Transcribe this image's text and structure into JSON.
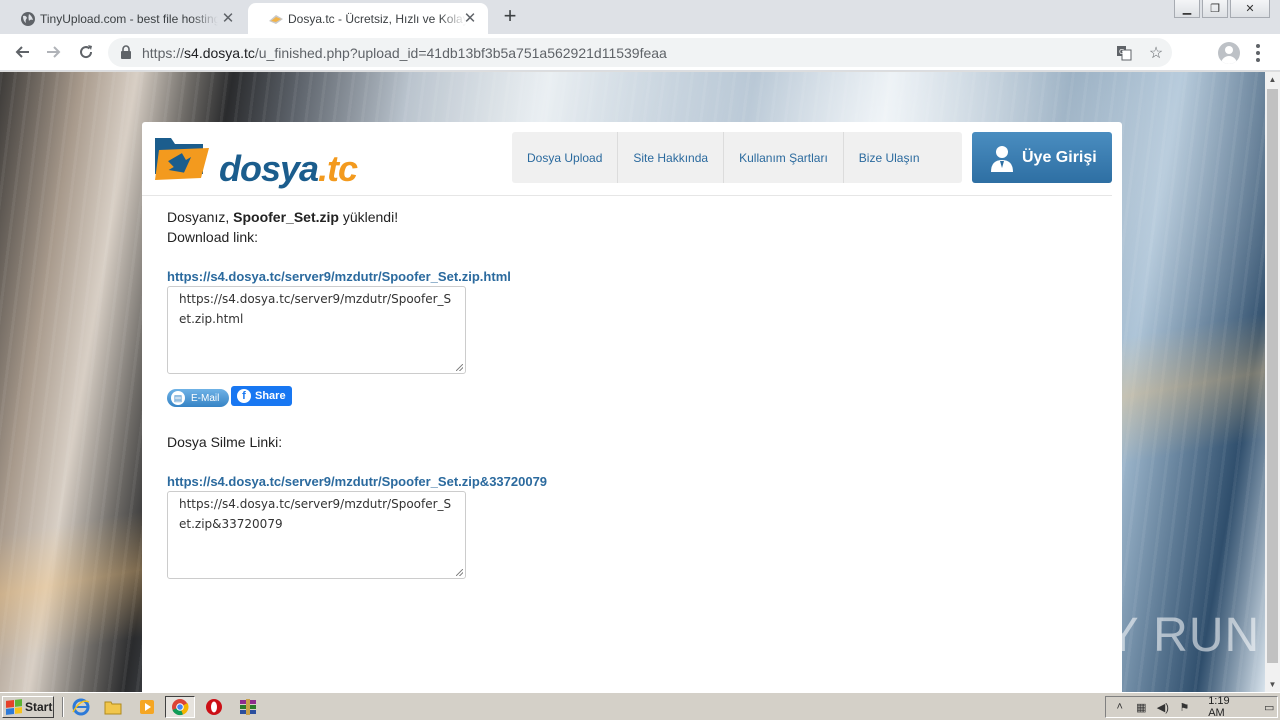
{
  "browser": {
    "tabs": [
      {
        "title": "TinyUpload.com - best file hosting solution",
        "active": false
      },
      {
        "title": "Dosya.tc - Ücretsiz, Hızlı ve Kolay Dosya Upload",
        "active": true
      }
    ],
    "url_scheme": "https://",
    "url_host": "s4.dosya.tc",
    "url_path": "/u_finished.php?upload_id=41db13bf3b5a751a562921d11539feaa"
  },
  "site": {
    "logo_main": "dosya",
    "logo_suffix": ".tc",
    "nav": [
      "Dosya Upload",
      "Site Hakkında",
      "Kullanım Şartları",
      "Bize Ulaşın"
    ],
    "login_label": "Üye Girişi"
  },
  "upload": {
    "prefix": "Dosyanız, ",
    "filename": "Spoofer_Set.zip",
    "suffix": " yüklendi!",
    "download_label": "Download link:",
    "download_link": "https://s4.dosya.tc/server9/mzdutr/Spoofer_Set.zip.html",
    "download_textarea": "https://s4.dosya.tc/server9/mzdutr/Spoofer_Set.zip.html",
    "email_label": "E-Mail",
    "share_label": "Share",
    "delete_label": "Dosya Silme Linki:",
    "delete_link": "https://s4.dosya.tc/server9/mzdutr/Spoofer_Set.zip&33720079",
    "delete_textarea": "https://s4.dosya.tc/server9/mzdutr/Spoofer_Set.zip&33720079"
  },
  "watermark": "ANY RUN",
  "taskbar": {
    "start_label": "Start",
    "clock": "1:19 AM"
  },
  "colors": {
    "brand_blue": "#1b5d8d",
    "brand_orange": "#f39a1e",
    "link": "#2b6a9e"
  }
}
